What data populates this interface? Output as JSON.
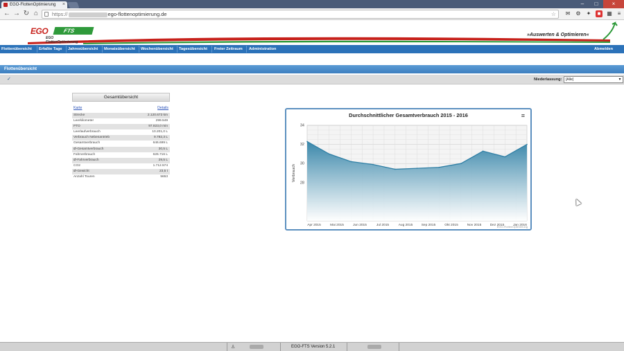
{
  "browser": {
    "tab_title": "EGO-FlottenOptimierung",
    "url_scheme": "https://",
    "url_domain": "ego-flottenoptimierung.de"
  },
  "header": {
    "logo_text": "EGO",
    "logo_badge": "FTS",
    "logo_subtitle": "EGO FlottenOptimierung",
    "slogan": "»Auswerten & Optimieren«"
  },
  "nav": {
    "items": [
      "Flottenübersicht",
      "Erfaßte Tage",
      "Jahresübersicht",
      "Monatsübersicht",
      "Wochenübersicht",
      "Tagesübersicht",
      "Freier Zeitraum",
      "Administration"
    ],
    "logout": "Abmelden"
  },
  "page": {
    "title": "Flottenübersicht",
    "niederlassung_label": "Niederlassung:",
    "niederlassung_value": "[Alle]"
  },
  "overview": {
    "title": "Gesamtübersicht",
    "link_left": "Karte",
    "link_right": "Details",
    "rows": [
      {
        "label": "Strecke",
        "value": "2.120.673 km"
      },
      {
        "label": "Leerkilometer",
        "value": "299.549"
      },
      {
        "label": "PTO",
        "value": "97.823,0 min"
      },
      {
        "label": "Leerlaufverbrauch",
        "value": "10.201,0 L"
      },
      {
        "label": "Verbrauch Nebenantrieb",
        "value": "9.782,3 L"
      },
      {
        "label": "Gesamtverbrauch",
        "value": "646.699 L"
      },
      {
        "label": "Ø-Gesamtverbrauch",
        "value": "30,5 L"
      },
      {
        "label": "Fahrverbrauch",
        "value": "626.716 L"
      },
      {
        "label": "Ø-Fahrverbrauch",
        "value": "29,5 L"
      },
      {
        "label": "CO2",
        "value": "1.712.574"
      },
      {
        "label": "Ø-Gewicht",
        "value": "23,5 t"
      },
      {
        "label": "Anzahl Touren",
        "value": "5653"
      }
    ]
  },
  "chart_data": {
    "type": "area",
    "title": "Durchschnittlicher Gesamtverbrauch 2015 - 2016",
    "ylabel": "Verbrauch",
    "xlabel": "",
    "categories": [
      "Apr 2015",
      "Mai 2015",
      "Jun 2015",
      "Jul 2015",
      "Aug 2015",
      "Sep 2015",
      "Okt 2015",
      "Nov 2015",
      "Dez 2015",
      "Jan 2016"
    ],
    "values": [
      32.3,
      31.0,
      30.2,
      29.9,
      29.4,
      29.5,
      29.6,
      30.0,
      31.3,
      30.7,
      32.0
    ],
    "ylim": [
      24,
      34
    ],
    "yticks": [
      28,
      30,
      32,
      34
    ],
    "grid": true,
    "credits": "EGO-FlottenOptimierung",
    "colors": {
      "line": "#2f7fa5",
      "fill_top": "#3a87aa",
      "fill_bottom": "#ffffff"
    }
  },
  "footer": {
    "version": "EGO-FTS Version 5.2.1"
  },
  "colors": {
    "nav_blue": "#2b72b9",
    "brand_red": "#c7211b",
    "brand_green": "#2f9a3b"
  }
}
